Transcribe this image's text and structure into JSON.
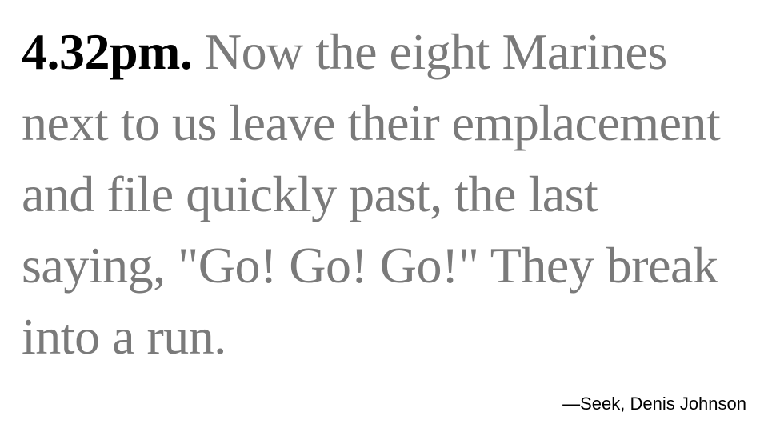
{
  "quote": {
    "time": "4.32pm.",
    "text": "Now the eight Marines next to us leave their emplacement and file quickly past, the last saying, \"Go! Go! Go!\" They break into a run."
  },
  "attribution": "—Seek, Denis Johnson",
  "colors": {
    "time": "#000000",
    "quote_text": "#7a7a7a",
    "attribution": "#000000",
    "background": "#ffffff"
  }
}
